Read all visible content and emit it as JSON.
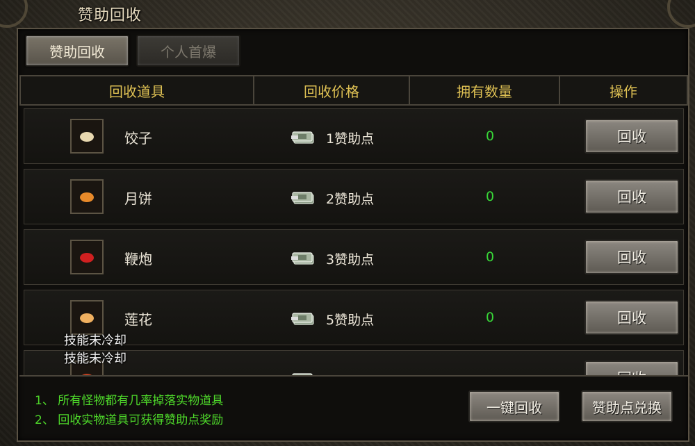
{
  "window": {
    "title": "赞助回收"
  },
  "tabs": [
    {
      "label": "赞助回收",
      "active": true
    },
    {
      "label": "个人首爆",
      "active": false
    }
  ],
  "table": {
    "columns": [
      "回收道具",
      "回收价格",
      "拥有数量",
      "操作"
    ],
    "rows": [
      {
        "name": "饺子",
        "price": "1赞助点",
        "owned": "0",
        "action": "回收",
        "icon": "dumpling-icon",
        "color": "#e8d8b0"
      },
      {
        "name": "月饼",
        "price": "2赞助点",
        "owned": "0",
        "action": "回收",
        "icon": "mooncake-icon",
        "color": "#e88a2a"
      },
      {
        "name": "鞭炮",
        "price": "3赞助点",
        "owned": "0",
        "action": "回收",
        "icon": "firecracker-icon",
        "color": "#d02020"
      },
      {
        "name": "莲花",
        "price": "5赞助点",
        "owned": "0",
        "action": "回收",
        "icon": "lotus-icon",
        "color": "#f0b060"
      },
      {
        "name": "",
        "price": "",
        "owned": "",
        "action": "回收",
        "icon": "item-icon",
        "color": "#c04020"
      }
    ]
  },
  "overlay": {
    "cooldown": [
      "技能未冷却",
      "技能未冷却"
    ]
  },
  "footer": {
    "tips": [
      "1、 所有怪物都有几率掉落实物道具",
      "2、 回收实物道具可获得赞助点奖励"
    ],
    "recycle_all": "一键回收",
    "exchange": "赞助点兑换"
  },
  "colors": {
    "gold_header": "#e0c254",
    "green_text": "#4ed82a",
    "count_green": "#38d838"
  }
}
